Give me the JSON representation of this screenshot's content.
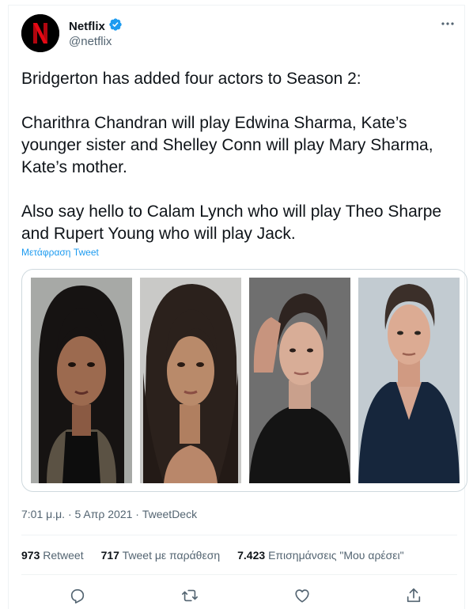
{
  "tweet": {
    "author": {
      "display_name": "Netflix",
      "handle": "@netflix",
      "verified": true,
      "avatar_letter": "N"
    },
    "text": "Bridgerton has added four actors to Season 2:\n\nCharithra Chandran will play Edwina Sharma, Kate’s younger sister and Shelley Conn will play Mary Sharma, Kate’s mother.\n\nAlso say hello to Calam Lynch who will play Theo Sharpe and Rupert Young who will play Jack.",
    "translate_label": "Μετάφραση Tweet",
    "timestamp": "7:01 μ.μ. · 5 Απρ 2021 · ",
    "source": "TweetDeck",
    "stats": {
      "retweets_count": "973",
      "retweets_label": "Retweet",
      "quotes_count": "717",
      "quotes_label": "Tweet με παράθεση",
      "likes_count": "7.423",
      "likes_label": "Επισημάνσεις \"Μου αρέσει\""
    },
    "actions": [
      "reply-icon",
      "retweet-icon",
      "like-icon",
      "share-icon"
    ],
    "media": [
      "actor-photo-1",
      "actor-photo-2",
      "actor-photo-3",
      "actor-photo-4"
    ]
  },
  "colors": {
    "brand_red": "#e50914",
    "verified_blue": "#1d9bf0",
    "secondary_text": "#536471"
  }
}
